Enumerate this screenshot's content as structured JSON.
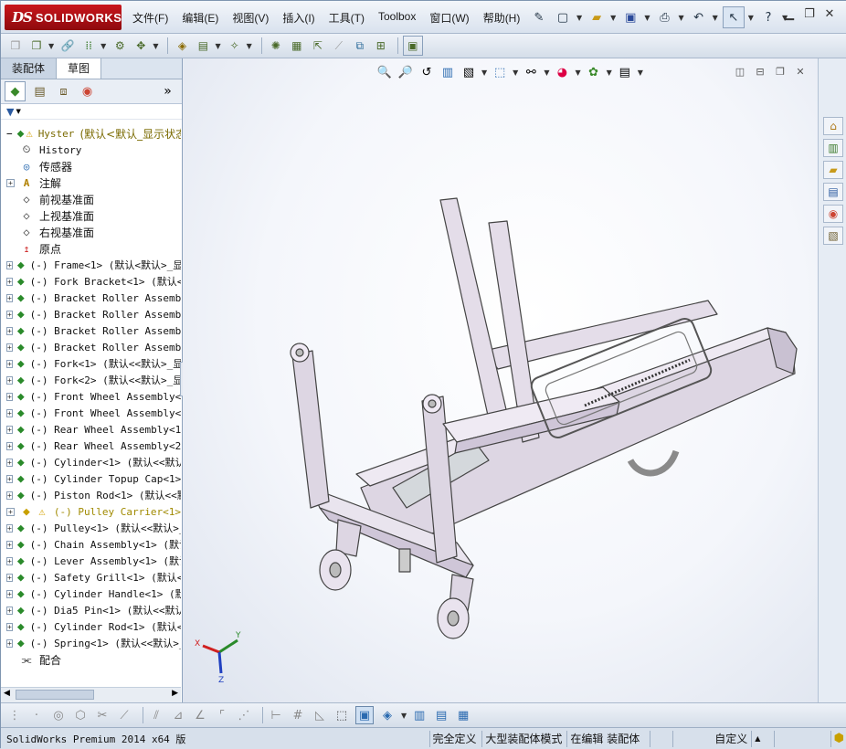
{
  "app": {
    "logo_ds": "DS",
    "logo_text": "SOLIDWORKS"
  },
  "menu": [
    "文件(F)",
    "编辑(E)",
    "视图(V)",
    "插入(I)",
    "工具(T)",
    "Toolbox",
    "窗口(W)",
    "帮助(H)"
  ],
  "tabs": [
    "装配体",
    "草图"
  ],
  "tree": {
    "root": {
      "name": "Hyster",
      "suffix": "(默认<默认_显示状态"
    },
    "fixed_items": [
      {
        "label": "History",
        "icon": "history-icon"
      },
      {
        "label": "传感器",
        "icon": "sensor-icon"
      },
      {
        "label": "注解",
        "icon": "annotation-icon"
      },
      {
        "label": "前视基准面",
        "icon": "plane-icon"
      },
      {
        "label": "上视基准面",
        "icon": "plane-icon"
      },
      {
        "label": "右视基准面",
        "icon": "plane-icon"
      },
      {
        "label": "原点",
        "icon": "origin-icon"
      }
    ],
    "components": [
      "(-) Frame<1> (默认<默认>_显",
      "(-) Fork Bracket<1> (默认<默",
      "(-) Bracket Roller Assembly",
      "(-) Bracket Roller Assembly",
      "(-) Bracket Roller Assembly",
      "(-) Bracket Roller Assembly",
      "(-) Fork<1> (默认<<默认>_显",
      "(-) Fork<2> (默认<<默认>_显",
      "(-) Front Wheel Assembly<1>",
      "(-) Front Wheel Assembly<2>",
      "(-) Rear Wheel Assembly<1>",
      "(-) Rear Wheel Assembly<2>",
      "(-) Cylinder<1> (默认<<默认",
      "(-) Cylinder Topup Cap<1> (",
      "(-) Piston Rod<1> (默认<<默",
      "(-) Pulley Carrier<1>",
      "(-) Pulley<1> (默认<<默认>_",
      "(-) Chain Assembly<1> (默认",
      "(-) Lever Assembly<1> (默认",
      "(-) Safety Grill<1> (默认<<",
      "(-) Cylinder Handle<1> (默",
      "(-) Dia5 Pin<1> (默认<<默认",
      "(-) Cylinder Rod<1> (默认<<",
      "(-) Spring<1> (默认<<默认>_"
    ],
    "mates": "配合"
  },
  "triad": {
    "x": "X",
    "y": "Y",
    "z": "Z"
  },
  "status": {
    "left": "SolidWorks Premium 2014 x64 版",
    "s1": "完全定义",
    "s2": "大型装配体模式",
    "s3": "在编辑 装配体",
    "s4": "自定义"
  }
}
